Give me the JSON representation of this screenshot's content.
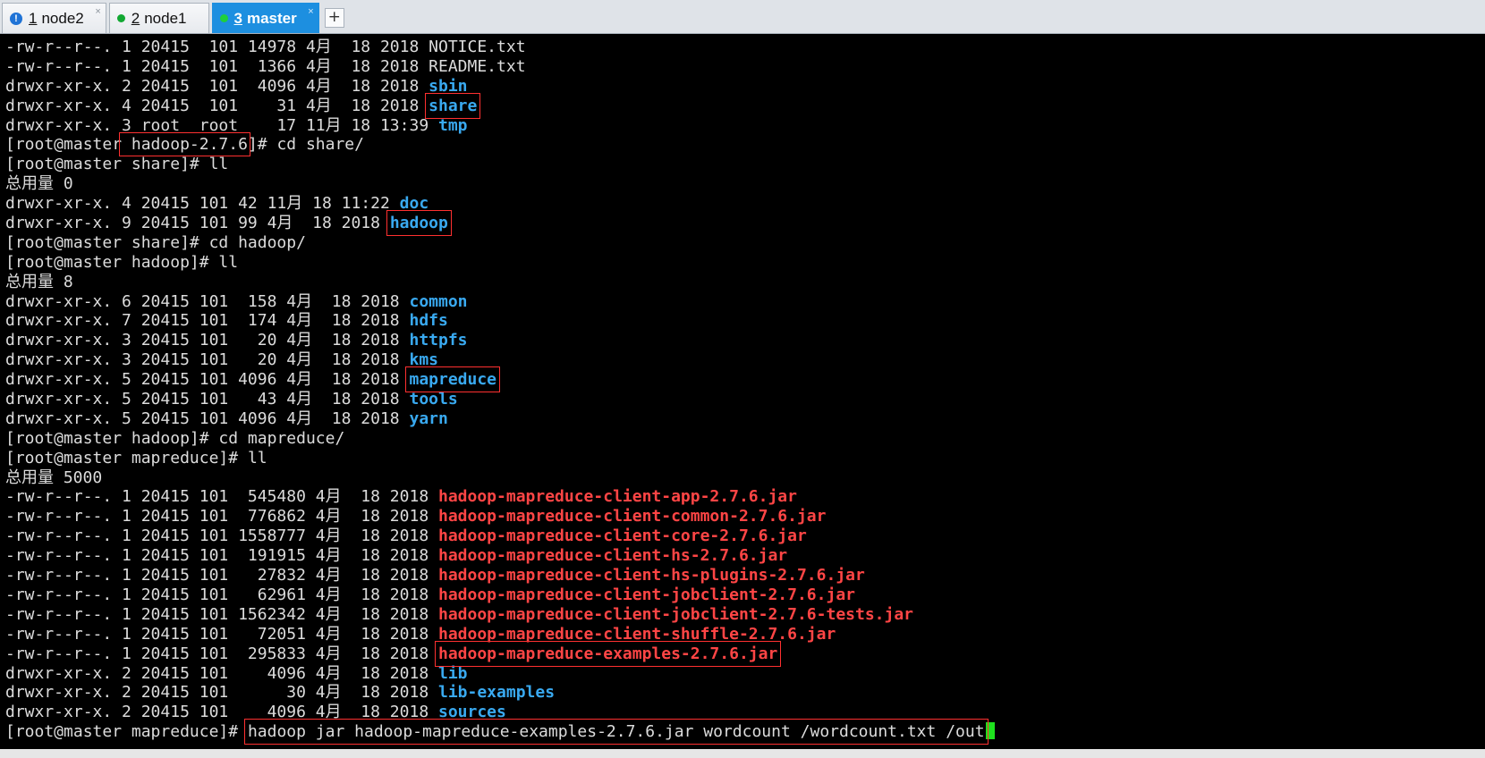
{
  "tabs": [
    {
      "number": "1",
      "label": "node2",
      "status": "warn",
      "status_glyph": "!",
      "close": "×",
      "active": false
    },
    {
      "number": "2",
      "label": "node1",
      "status": "ok",
      "status_glyph": "",
      "close": "",
      "active": false
    },
    {
      "number": "3",
      "label": "master",
      "status": "ok",
      "status_glyph": "",
      "close": "×",
      "active": true
    }
  ],
  "new_tab_label": "+",
  "terminal": {
    "lines": [
      {
        "type": "entry",
        "meta": "-rw-r--r--. 1 20415  101 14978 4月  18 2018 ",
        "name": "NOTICE.txt",
        "kind": "file"
      },
      {
        "type": "entry",
        "meta": "-rw-r--r--. 1 20415  101  1366 4月  18 2018 ",
        "name": "README.txt",
        "kind": "file"
      },
      {
        "type": "entry",
        "meta": "drwxr-xr-x. 2 20415  101  4096 4月  18 2018 ",
        "name": "sbin",
        "kind": "dir"
      },
      {
        "type": "entry",
        "meta": "drwxr-xr-x. 4 20415  101    31 4月  18 2018 ",
        "name": "share",
        "kind": "dir",
        "boxed": true
      },
      {
        "type": "entry",
        "meta": "drwxr-xr-x. 3 root  root    17 11月 18 13:39 ",
        "name": "tmp",
        "kind": "dir"
      },
      {
        "type": "prompt",
        "prompt": "[root@master hadoop-2.7.6]# ",
        "command": "cd share/",
        "host_boxed": " hadoop-2.7.6"
      },
      {
        "type": "prompt",
        "prompt": "[root@master share]# ",
        "command": "ll"
      },
      {
        "type": "text",
        "text": "总用量 0"
      },
      {
        "type": "entry",
        "meta": "drwxr-xr-x. 4 20415 101 42 11月 18 11:22 ",
        "name": "doc",
        "kind": "dir"
      },
      {
        "type": "entry",
        "meta": "drwxr-xr-x. 9 20415 101 99 4月  18 2018 ",
        "name": "hadoop",
        "kind": "dir",
        "boxed": true
      },
      {
        "type": "prompt",
        "prompt": "[root@master share]# ",
        "command": "cd hadoop/"
      },
      {
        "type": "prompt",
        "prompt": "[root@master hadoop]# ",
        "command": "ll"
      },
      {
        "type": "text",
        "text": "总用量 8"
      },
      {
        "type": "entry",
        "meta": "drwxr-xr-x. 6 20415 101  158 4月  18 2018 ",
        "name": "common",
        "kind": "dir"
      },
      {
        "type": "entry",
        "meta": "drwxr-xr-x. 7 20415 101  174 4月  18 2018 ",
        "name": "hdfs",
        "kind": "dir"
      },
      {
        "type": "entry",
        "meta": "drwxr-xr-x. 3 20415 101   20 4月  18 2018 ",
        "name": "httpfs",
        "kind": "dir"
      },
      {
        "type": "entry",
        "meta": "drwxr-xr-x. 3 20415 101   20 4月  18 2018 ",
        "name": "kms",
        "kind": "dir"
      },
      {
        "type": "entry",
        "meta": "drwxr-xr-x. 5 20415 101 4096 4月  18 2018 ",
        "name": "mapreduce",
        "kind": "dir",
        "boxed": true
      },
      {
        "type": "entry",
        "meta": "drwxr-xr-x. 5 20415 101   43 4月  18 2018 ",
        "name": "tools",
        "kind": "dir"
      },
      {
        "type": "entry",
        "meta": "drwxr-xr-x. 5 20415 101 4096 4月  18 2018 ",
        "name": "yarn",
        "kind": "dir"
      },
      {
        "type": "prompt",
        "prompt": "[root@master hadoop]# ",
        "command": "cd mapreduce/"
      },
      {
        "type": "prompt",
        "prompt": "[root@master mapreduce]# ",
        "command": "ll"
      },
      {
        "type": "text",
        "text": "总用量 5000"
      },
      {
        "type": "entry",
        "meta": "-rw-r--r--. 1 20415 101  545480 4月  18 2018 ",
        "name": "hadoop-mapreduce-client-app-2.7.6.jar",
        "kind": "jar"
      },
      {
        "type": "entry",
        "meta": "-rw-r--r--. 1 20415 101  776862 4月  18 2018 ",
        "name": "hadoop-mapreduce-client-common-2.7.6.jar",
        "kind": "jar"
      },
      {
        "type": "entry",
        "meta": "-rw-r--r--. 1 20415 101 1558777 4月  18 2018 ",
        "name": "hadoop-mapreduce-client-core-2.7.6.jar",
        "kind": "jar"
      },
      {
        "type": "entry",
        "meta": "-rw-r--r--. 1 20415 101  191915 4月  18 2018 ",
        "name": "hadoop-mapreduce-client-hs-2.7.6.jar",
        "kind": "jar"
      },
      {
        "type": "entry",
        "meta": "-rw-r--r--. 1 20415 101   27832 4月  18 2018 ",
        "name": "hadoop-mapreduce-client-hs-plugins-2.7.6.jar",
        "kind": "jar"
      },
      {
        "type": "entry",
        "meta": "-rw-r--r--. 1 20415 101   62961 4月  18 2018 ",
        "name": "hadoop-mapreduce-client-jobclient-2.7.6.jar",
        "kind": "jar"
      },
      {
        "type": "entry",
        "meta": "-rw-r--r--. 1 20415 101 1562342 4月  18 2018 ",
        "name": "hadoop-mapreduce-client-jobclient-2.7.6-tests.jar",
        "kind": "jar"
      },
      {
        "type": "entry",
        "meta": "-rw-r--r--. 1 20415 101   72051 4月  18 2018 ",
        "name": "hadoop-mapreduce-client-shuffle-2.7.6.jar",
        "kind": "jar"
      },
      {
        "type": "entry",
        "meta": "-rw-r--r--. 1 20415 101  295833 4月  18 2018 ",
        "name": "hadoop-mapreduce-examples-2.7.6.jar",
        "kind": "jar",
        "boxed": true
      },
      {
        "type": "entry",
        "meta": "drwxr-xr-x. 2 20415 101    4096 4月  18 2018 ",
        "name": "lib",
        "kind": "dir"
      },
      {
        "type": "entry",
        "meta": "drwxr-xr-x. 2 20415 101      30 4月  18 2018 ",
        "name": "lib-examples",
        "kind": "dir"
      },
      {
        "type": "entry",
        "meta": "drwxr-xr-x. 2 20415 101    4096 4月  18 2018 ",
        "name": "sources",
        "kind": "dir"
      },
      {
        "type": "prompt",
        "prompt": "[root@master mapreduce]# ",
        "command": "hadoop jar hadoop-mapreduce-examples-2.7.6.jar wordcount /wordcount.txt /out",
        "command_boxed": true,
        "cursor": true
      }
    ]
  }
}
